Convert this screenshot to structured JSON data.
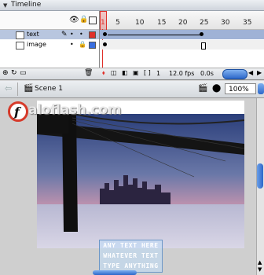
{
  "timeline": {
    "title": "Timeline",
    "ruler_numbers": [
      "1",
      "5",
      "10",
      "15",
      "20",
      "25",
      "30",
      "35"
    ],
    "layers": [
      {
        "name": "text",
        "selected": true,
        "color": "#e0302a"
      },
      {
        "name": "image",
        "selected": false,
        "color": "#3a6fe0"
      }
    ],
    "fps": "12.0 fps",
    "time": "0.0s",
    "frame": "1"
  },
  "editbar": {
    "scene": "Scene 1",
    "zoom": "100%"
  },
  "stage": {
    "logo_text": "aloflash.com",
    "text_lines": [
      "ANY TEXT HERE",
      "WHATEVER TEXT",
      "TYPE ANYTHING"
    ]
  },
  "colors": {
    "accent": "#2c67c9",
    "playhead": "#e0302a"
  }
}
